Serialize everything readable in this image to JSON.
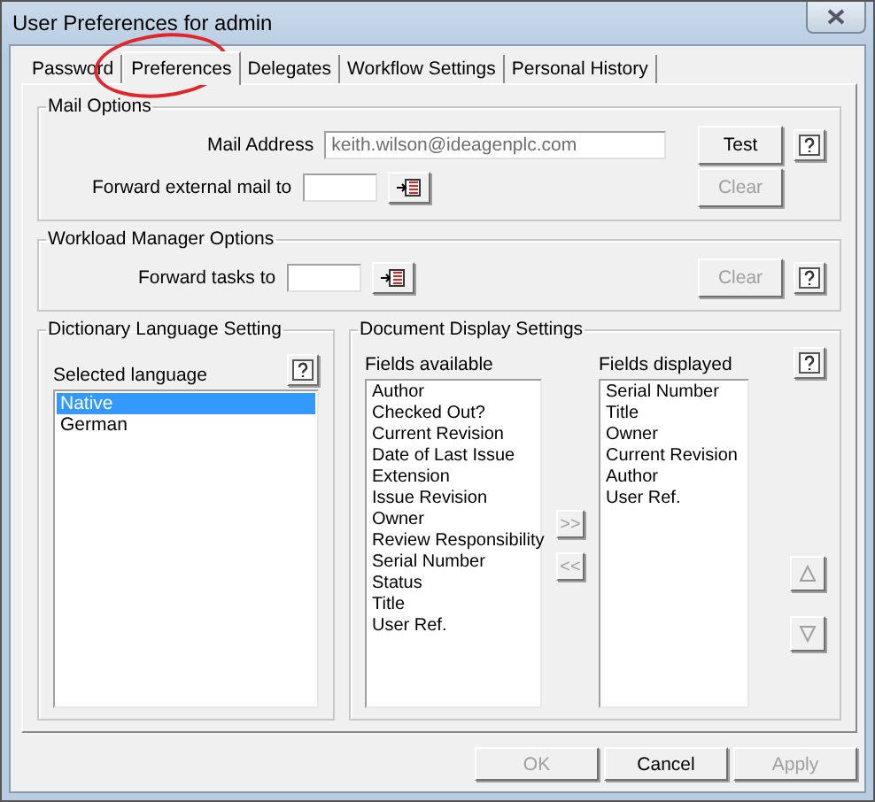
{
  "window": {
    "title": "User Preferences for admin"
  },
  "tabs": [
    {
      "label": "Password",
      "selected": false
    },
    {
      "label": "Preferences",
      "selected": true
    },
    {
      "label": "Delegates",
      "selected": false
    },
    {
      "label": "Workflow Settings",
      "selected": false
    },
    {
      "label": "Personal History",
      "selected": false
    }
  ],
  "mail_options": {
    "title": "Mail Options",
    "mail_address": {
      "label": "Mail Address",
      "value": "keith.wilson@ideagenplc.com"
    },
    "test_button": {
      "label": "Test",
      "disabled": false
    },
    "forward_label": "Forward external mail to",
    "clear_button": {
      "label": "Clear",
      "disabled": true
    }
  },
  "workload_options": {
    "title": "Workload Manager Options",
    "forward_label": "Forward tasks to",
    "clear_button": {
      "label": "Clear",
      "disabled": true
    }
  },
  "dictionary": {
    "title": "Dictionary Language Setting",
    "list_label": "Selected language",
    "items": [
      {
        "label": "Native",
        "selected": true
      },
      {
        "label": "German",
        "selected": false
      }
    ]
  },
  "document_display": {
    "title": "Document Display Settings",
    "available_label": "Fields available",
    "available": [
      "Author",
      "Checked Out?",
      "Current Revision",
      "Date of Last Issue",
      "Extension",
      "Issue Revision",
      "Owner",
      "Review Responsibility",
      "Serial Number",
      "Status",
      "Title",
      "User Ref."
    ],
    "add_button": {
      "label": ">>",
      "disabled": true
    },
    "remove_button": {
      "label": "<<",
      "disabled": true
    },
    "displayed_label": "Fields displayed",
    "displayed": [
      "Serial Number",
      "Title",
      "Owner",
      "Current Revision",
      "Author",
      "User Ref."
    ],
    "move_up": {
      "disabled": true
    },
    "move_down": {
      "disabled": true
    }
  },
  "buttons": [
    {
      "label": "OK",
      "disabled": true
    },
    {
      "label": "Cancel",
      "disabled": false
    },
    {
      "label": "Apply",
      "disabled": true
    }
  ]
}
